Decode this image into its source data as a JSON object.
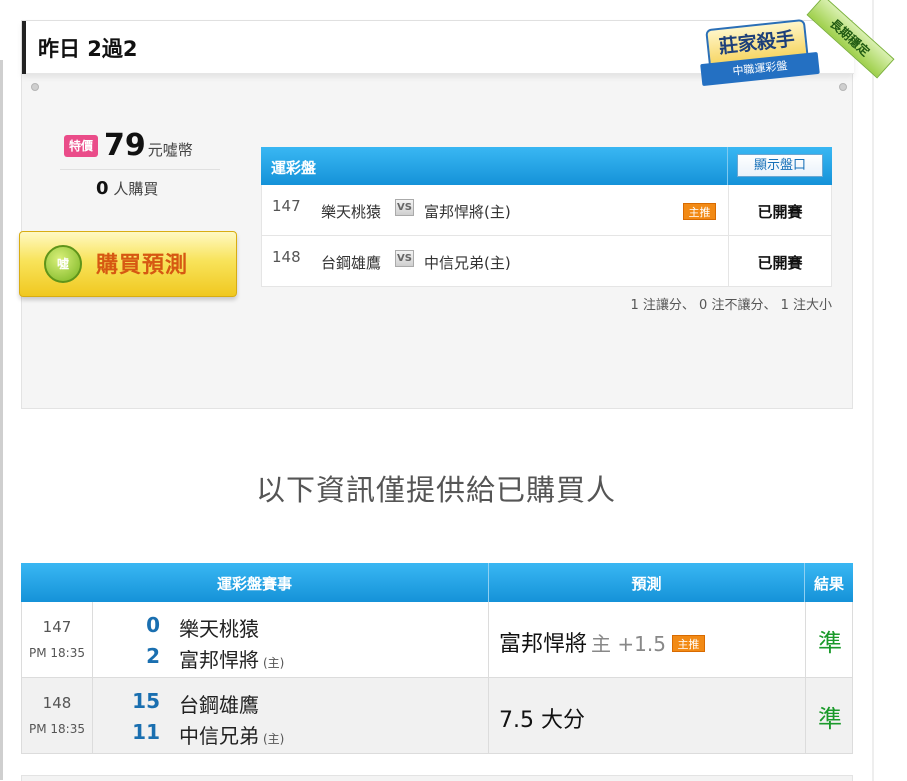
{
  "header": {
    "title": "昨日 2過2"
  },
  "badge": {
    "main": "莊家殺手",
    "ribbon": "中職運彩盤",
    "corner": "長期穩定"
  },
  "price": {
    "tag": "特價",
    "amount": "79",
    "unit": "元噓幣"
  },
  "buyers": {
    "count": "0",
    "label": "人購買"
  },
  "buy_button": {
    "coin": "噓",
    "label": "購買預測"
  },
  "odds_table": {
    "title": "運彩盤",
    "show_button": "顯示盤口",
    "vs": "VS",
    "rows": [
      {
        "no": "147",
        "team1": "樂天桃猿",
        "team2": "富邦悍將(主)",
        "tag": "主推",
        "status": "已開賽"
      },
      {
        "no": "148",
        "team1": "台鋼雄鷹",
        "team2": "中信兄弟(主)",
        "status": "已開賽"
      }
    ],
    "note": "1 注讓分、 0 注不讓分、 1 注大小"
  },
  "info_line": "以下資訊僅提供給已購買人",
  "results_table": {
    "headers": {
      "match": "運彩盤賽事",
      "prediction": "預測",
      "result": "結果"
    },
    "rows": [
      {
        "no": "147",
        "time": "PM 18:35",
        "score1": "0",
        "team1": "樂天桃猿",
        "score2": "2",
        "team2": "富邦悍將",
        "host_mark": "(主)",
        "prediction": "富邦悍將",
        "handicap": "主 +1.5",
        "tag": "主推",
        "result": "準"
      },
      {
        "no": "148",
        "time": "PM 18:35",
        "score1": "15",
        "team1": "台鋼雄鷹",
        "score2": "11",
        "team2": "中信兄弟",
        "host_mark": "(主)",
        "prediction": "7.5 大分",
        "result": "準"
      }
    ]
  },
  "colors": {
    "header_blue": "#1592d8",
    "accent_orange": "#f28a15",
    "result_green": "#1a9a2a",
    "buy_button_yellow": "#f8e35a"
  }
}
